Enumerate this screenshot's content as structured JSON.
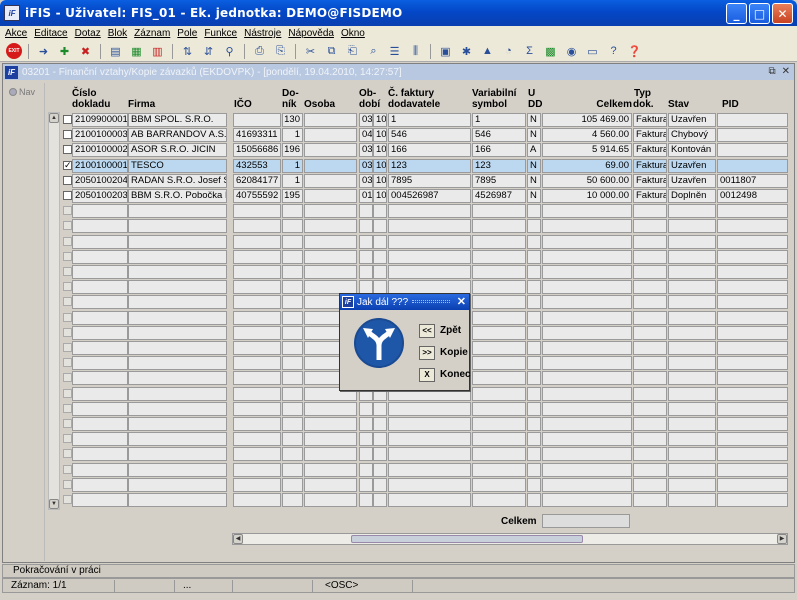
{
  "window": {
    "title": "iFIS - Uživatel: FIS_01 - Ek. jednotka: DEMO@FISDEMO"
  },
  "menu": [
    "Akce",
    "Editace",
    "Dotaz",
    "Blok",
    "Záznam",
    "Pole",
    "Funkce",
    "Nástroje",
    "Nápověda",
    "Okno"
  ],
  "toolbar": {
    "exit_label": "EXIT"
  },
  "form": {
    "title": "03201 - Finanční vztahy/Kopie závazků (EKDOVPK) - [pondělí, 19.04.2010, 14:27:57]",
    "nav_label": "Nav"
  },
  "columns": {
    "cislo": [
      "Číslo",
      "dokladu"
    ],
    "firma": "Firma",
    "ico": "IČO",
    "donik": [
      "Do-",
      "ník"
    ],
    "osoba": "Osoba",
    "obdobi": [
      "Ob-",
      "dobí"
    ],
    "faktura": [
      "Č. faktury",
      "dodavatele"
    ],
    "vs": [
      "Variabilní",
      "symbol"
    ],
    "udd": [
      "U",
      "DD"
    ],
    "celkem": "Celkem",
    "typ": [
      "Typ",
      "dok."
    ],
    "stav": "Stav",
    "pid": "PID"
  },
  "rows": [
    {
      "checked": false,
      "cislo": "2109900001",
      "firma": "BBM SPOL. S.R.O.",
      "ico": "",
      "donik": "130",
      "osoba": "",
      "ob1": "03",
      "ob2": "10",
      "faktura": "1",
      "vs": "1",
      "udd": "N",
      "celkem": "105 469.00",
      "typ": "Faktura",
      "stav": "Uzavřen",
      "pid": ""
    },
    {
      "checked": false,
      "cislo": "2100100003",
      "firma": "AB BARRANDOV A.S.",
      "ico": "41693311",
      "donik": "1",
      "osoba": "",
      "ob1": "04",
      "ob2": "10",
      "faktura": "546",
      "vs": "546",
      "udd": "N",
      "celkem": "4 560.00",
      "typ": "Faktura",
      "stav": "Chybový",
      "pid": ""
    },
    {
      "checked": false,
      "cislo": "2100100002",
      "firma": "ASOR S.R.O. JICIN",
      "ico": "15056686",
      "donik": "196",
      "osoba": "",
      "ob1": "03",
      "ob2": "10",
      "faktura": "166",
      "vs": "166",
      "udd": "A",
      "celkem": "5 914.65",
      "typ": "Faktura",
      "stav": "Kontován",
      "pid": ""
    },
    {
      "checked": true,
      "cislo": "2100100001",
      "firma": "TESCO",
      "ico": "432553",
      "donik": "1",
      "osoba": "",
      "ob1": "03",
      "ob2": "10",
      "faktura": "123",
      "vs": "123",
      "udd": "N",
      "celkem": "69.00",
      "typ": "Faktura",
      "stav": "Uzavřen",
      "pid": ""
    },
    {
      "checked": false,
      "cislo": "2050100204",
      "firma": "RADAN S.R.O. Josef Slav",
      "ico": "62084177",
      "donik": "1",
      "osoba": "",
      "ob1": "03",
      "ob2": "10",
      "faktura": "7895",
      "vs": "7895",
      "udd": "N",
      "celkem": "50 600.00",
      "typ": "Faktura",
      "stav": "Uzavřen",
      "pid": "0011807"
    },
    {
      "checked": false,
      "cislo": "2050100203",
      "firma": "BBM S.R.O. Pobočka Prah",
      "ico": "40755592",
      "donik": "195",
      "osoba": "",
      "ob1": "01",
      "ob2": "10",
      "faktura": "004526987",
      "vs": "4526987",
      "udd": "N",
      "celkem": "10 000.00",
      "typ": "Faktura",
      "stav": "Doplněn",
      "pid": "0012498"
    }
  ],
  "footer": {
    "celkem_label": "Celkem",
    "celkem_value": ""
  },
  "dialog": {
    "title": "Jak dál ???",
    "btn_back_sym": "<<",
    "btn_back": "Zpět",
    "btn_copy_sym": ">>",
    "btn_copy": "Kopie",
    "btn_end_sym": "X",
    "btn_end": "Konec"
  },
  "status": {
    "message": "Pokračování v práci",
    "record": "Záznam: 1/1",
    "seg3": "...",
    "seg4": "<OSC>"
  }
}
